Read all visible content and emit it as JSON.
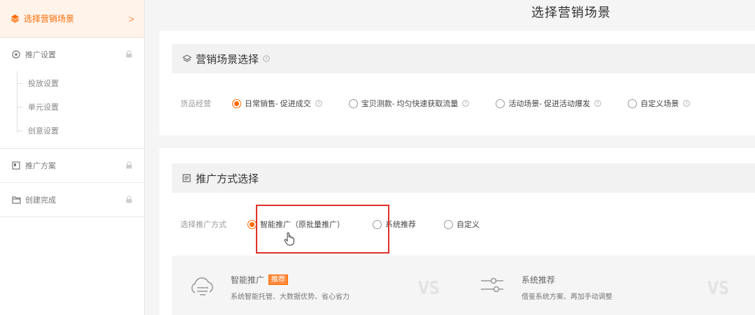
{
  "page_title": "选择营销场景",
  "sidebar": {
    "active": {
      "label": "选择营销场景",
      "chevron": ">"
    },
    "groups": [
      {
        "label": "推广设置",
        "sub": [
          "投放设置",
          "单元设置",
          "创意设置"
        ]
      },
      {
        "label": "推广方案",
        "sub": []
      },
      {
        "label": "创建完成",
        "sub": []
      }
    ]
  },
  "scene_section": {
    "title": "营销场景选择",
    "row_label": "货品经营",
    "options": [
      {
        "label": "日常销售- 促进成交",
        "selected": true
      },
      {
        "label": "宝贝测款- 均匀快速获取流量",
        "selected": false
      },
      {
        "label": "活动场景- 促进活动爆发",
        "selected": false
      },
      {
        "label": "自定义场景",
        "selected": false
      }
    ]
  },
  "method_section": {
    "title": "推广方式选择",
    "row_label": "选择推广方式",
    "options": [
      {
        "label": "智能推广（原批量推广）",
        "selected": true
      },
      {
        "label": "系统推荐",
        "selected": false
      },
      {
        "label": "自定义",
        "selected": false
      }
    ],
    "compare": {
      "smart": {
        "title": "智能推广",
        "badge": "推荐",
        "desc": "系统智能托管、大数据优势、省心省力"
      },
      "vs1": "VS",
      "system": {
        "title": "系统推荐",
        "desc": "借鉴系统方案、再加手动调整"
      },
      "vs2": "VS"
    }
  },
  "colors": {
    "accent": "#ff6a00",
    "highlight_border": "#e0302a"
  }
}
